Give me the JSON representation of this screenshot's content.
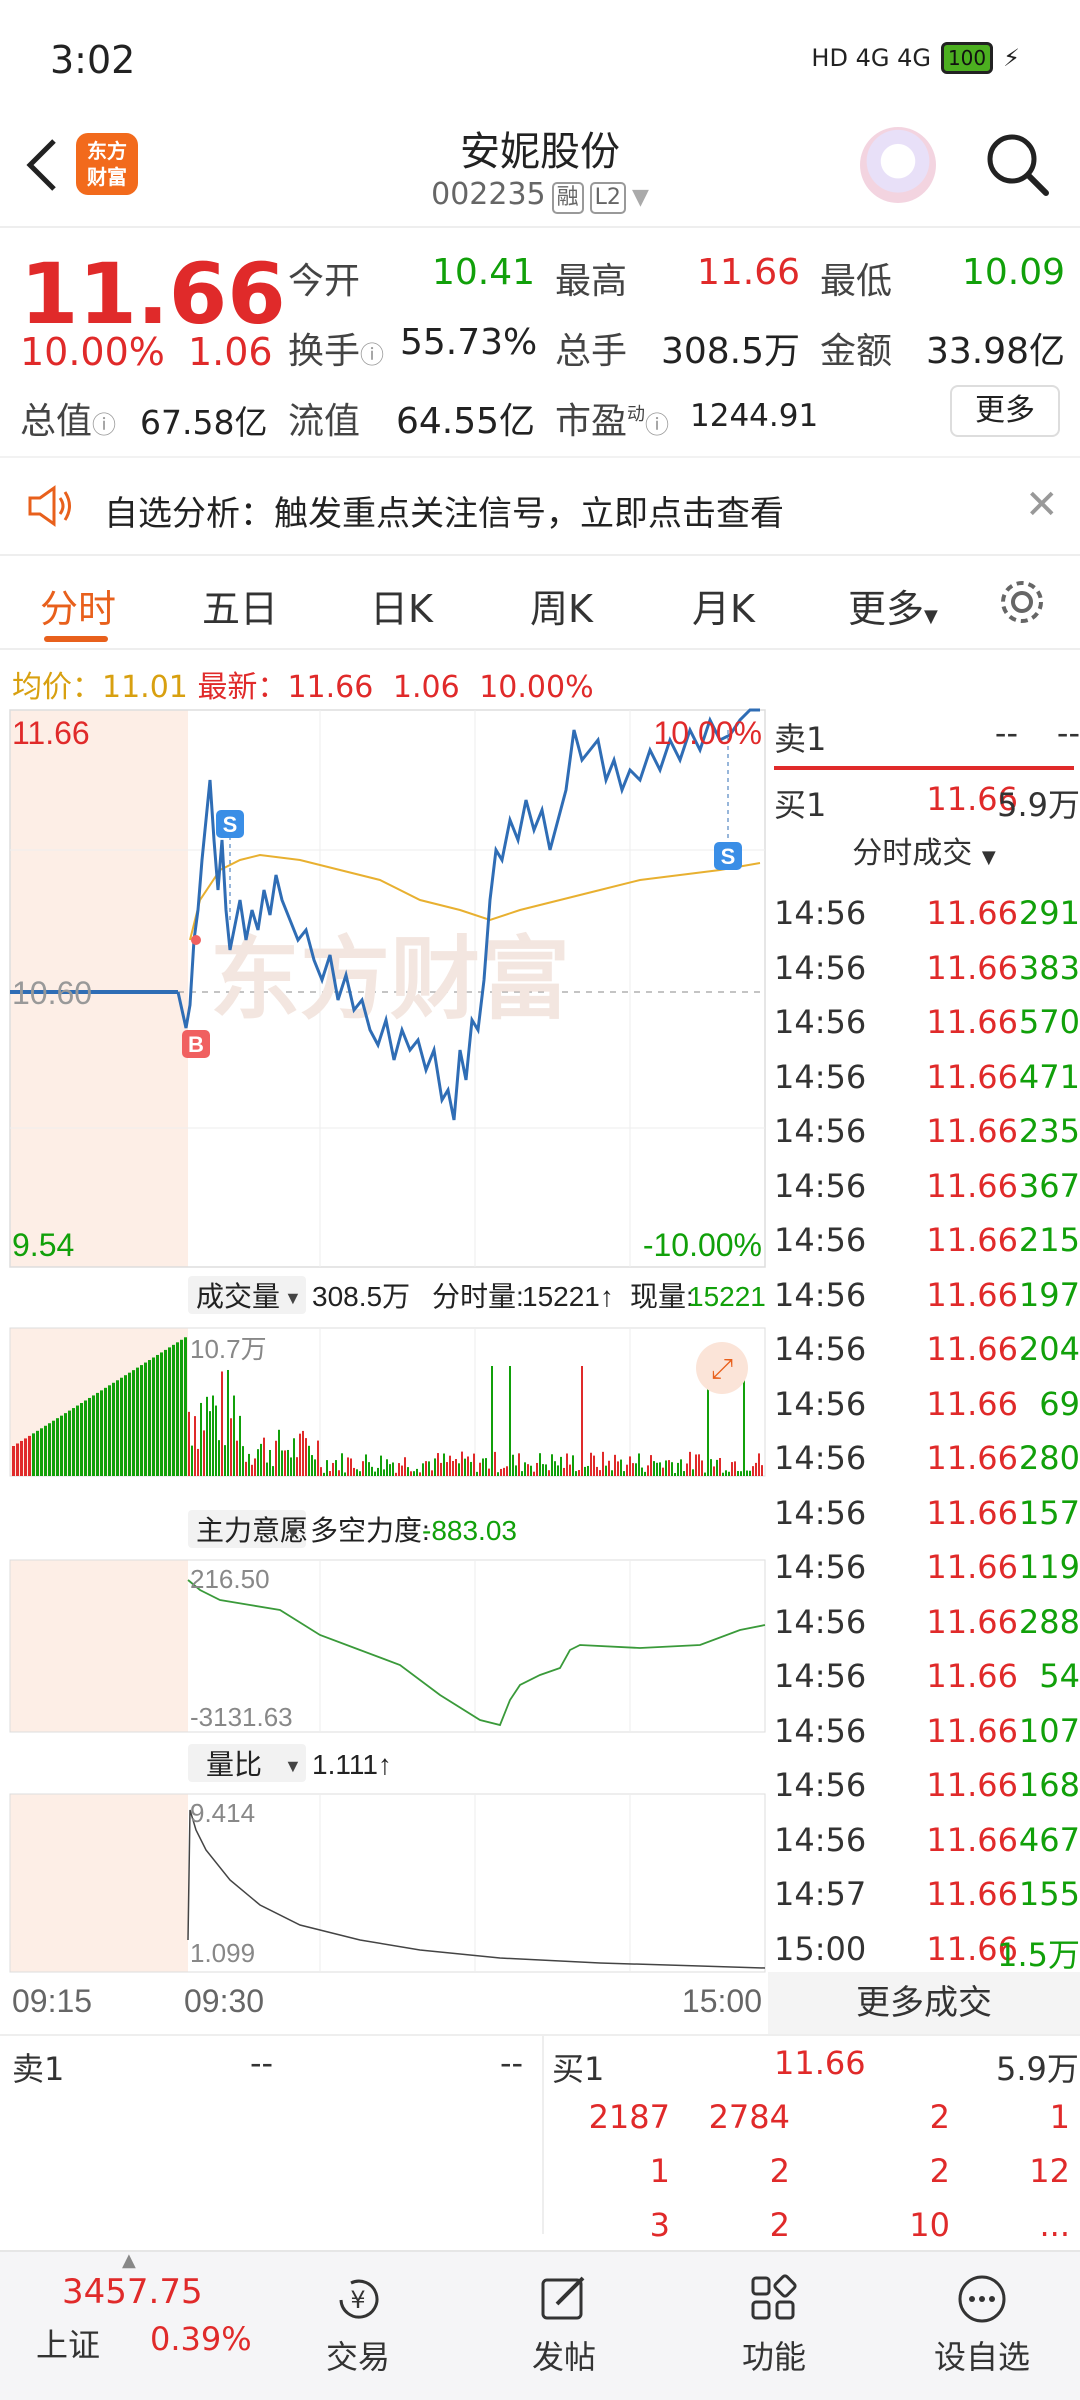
{
  "status_bar": {
    "time": "3:02",
    "network": "HD 4G 4G",
    "battery": "100"
  },
  "header": {
    "logo_text_1": "东方",
    "logo_text_2": "财富",
    "stock_name": "安妮股份",
    "stock_code": "002235",
    "tag_margin": "融",
    "tag_level": "L2"
  },
  "quote": {
    "price": "11.66",
    "change_pct": "10.00%",
    "change": "1.06",
    "open_label": "今开",
    "open": "10.41",
    "high_label": "最高",
    "high": "11.66",
    "low_label": "最低",
    "low": "10.09",
    "turnover_label": "换手",
    "turnover": "55.73%",
    "volume_label": "总手",
    "volume": "308.5万",
    "amount_label": "金额",
    "amount": "33.98亿",
    "mktcap_label": "总值",
    "mktcap": "67.58亿",
    "float_label": "流值",
    "float": "64.55亿",
    "pe_label": "市盈",
    "pe_sup": "动",
    "pe": "1244.91",
    "more_label": "更多"
  },
  "alert": {
    "text": "自选分析：触发重点关注信号，立即点击查看"
  },
  "tabs": [
    "分时",
    "五日",
    "日K",
    "周K",
    "月K",
    "更多"
  ],
  "info_line": {
    "avg_label": "均价：",
    "avg": "11.01",
    "last_label": "最新：",
    "last": "11.66",
    "chg": "1.06",
    "pct": "10.00%"
  },
  "chart": {
    "price_top": "11.66",
    "price_mid": "10.60",
    "price_bottom": "9.54",
    "pct_top": "10.00%",
    "pct_bottom": "-10.00%",
    "watermark": "东方财富",
    "volume_selector": "成交量",
    "volume_total": "308.5万",
    "tick_vol_label": "分时量:",
    "tick_vol": "15221↑",
    "cur_vol_label": "现量:",
    "cur_vol": "15221",
    "vol_max": "10.7万",
    "force_selector": "主力意愿",
    "force_label": "多空力度:",
    "force_value": "-883.03",
    "force_top": "216.50",
    "force_bottom": "-3131.63",
    "ratio_selector": "量比",
    "ratio_value": "1.111↑",
    "ratio_top": "9.414",
    "ratio_bottom": "1.099",
    "time_labels": [
      "09:15",
      "09:30",
      "15:00"
    ],
    "markers": {
      "buy": "B",
      "sell": "S"
    }
  },
  "right_panel": {
    "ask1_label": "卖1",
    "ask1_price": "--",
    "ask1_vol": "--",
    "bid1_label": "买1",
    "bid1_price": "11.66",
    "bid1_vol": "5.9万",
    "trades_title": "分时成交",
    "trades": [
      {
        "t": "14:56",
        "p": "11.66",
        "v": "291"
      },
      {
        "t": "14:56",
        "p": "11.66",
        "v": "383"
      },
      {
        "t": "14:56",
        "p": "11.66",
        "v": "570"
      },
      {
        "t": "14:56",
        "p": "11.66",
        "v": "471"
      },
      {
        "t": "14:56",
        "p": "11.66",
        "v": "235"
      },
      {
        "t": "14:56",
        "p": "11.66",
        "v": "367"
      },
      {
        "t": "14:56",
        "p": "11.66",
        "v": "215"
      },
      {
        "t": "14:56",
        "p": "11.66",
        "v": "197"
      },
      {
        "t": "14:56",
        "p": "11.66",
        "v": "204"
      },
      {
        "t": "14:56",
        "p": "11.66",
        "v": "69"
      },
      {
        "t": "14:56",
        "p": "11.66",
        "v": "280"
      },
      {
        "t": "14:56",
        "p": "11.66",
        "v": "157"
      },
      {
        "t": "14:56",
        "p": "11.66",
        "v": "119"
      },
      {
        "t": "14:56",
        "p": "11.66",
        "v": "288"
      },
      {
        "t": "14:56",
        "p": "11.66",
        "v": "54"
      },
      {
        "t": "14:56",
        "p": "11.66",
        "v": "107"
      },
      {
        "t": "14:56",
        "p": "11.66",
        "v": "168"
      },
      {
        "t": "14:56",
        "p": "11.66",
        "v": "467"
      },
      {
        "t": "14:57",
        "p": "11.66",
        "v": "155"
      },
      {
        "t": "15:00",
        "p": "11.66",
        "v": "1.5万"
      }
    ],
    "more_trades": "更多成交"
  },
  "order_book": {
    "ask_label": "卖1",
    "ask_price": "--",
    "ask_vol": "--",
    "bid_label": "买1",
    "bid_price": "11.66",
    "bid_vol": "5.9万",
    "queue": [
      [
        "2187",
        "2784",
        "2",
        "1"
      ],
      [
        "1",
        "2",
        "2",
        "12"
      ],
      [
        "3",
        "2",
        "10",
        "..."
      ]
    ]
  },
  "bottom_nav": {
    "index_value": "3457.75",
    "index_name": "上证",
    "index_pct": "0.39%",
    "items": [
      "交易",
      "发帖",
      "功能",
      "设自选"
    ]
  },
  "colors": {
    "up": "#e02a2a",
    "down": "#11a00a",
    "accent": "#e8601c",
    "price_line": "#2f6db5",
    "avg_line": "#e8b030"
  }
}
